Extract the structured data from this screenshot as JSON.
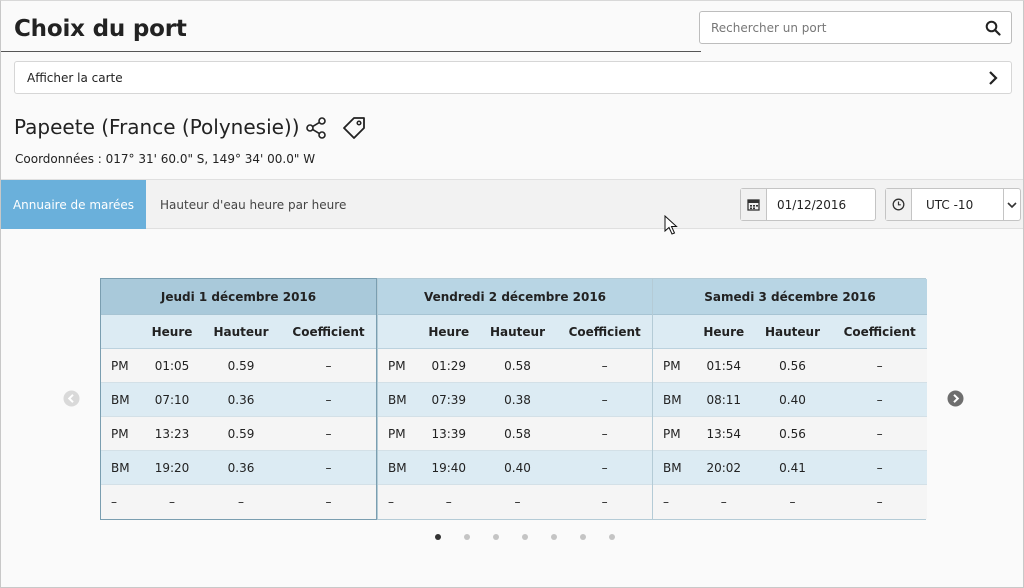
{
  "header": {
    "title": "Choix du port",
    "search_placeholder": "Rechercher un port"
  },
  "map_bar": {
    "label": "Afficher la carte"
  },
  "port": {
    "name": "Papeete (France (Polynesie))",
    "coordinates": "Coordonnées : 017° 31' 60.0\" S, 149° 34' 00.0\" W"
  },
  "tabs": [
    {
      "label": "Annuaire de marées",
      "active": true
    },
    {
      "label": "Hauteur d'eau heure par heure",
      "active": false
    }
  ],
  "controls": {
    "date": "01/12/2016",
    "timezone": "UTC -10"
  },
  "columns": {
    "time": "Heure",
    "height": "Hauteur",
    "coef": "Coefficient"
  },
  "days": [
    {
      "title": "Jeudi 1 décembre 2016",
      "rows": [
        {
          "type": "PM",
          "time": "01:05",
          "height": "0.59",
          "coef": "–"
        },
        {
          "type": "BM",
          "time": "07:10",
          "height": "0.36",
          "coef": "–"
        },
        {
          "type": "PM",
          "time": "13:23",
          "height": "0.59",
          "coef": "–"
        },
        {
          "type": "BM",
          "time": "19:20",
          "height": "0.36",
          "coef": "–"
        },
        {
          "type": "–",
          "time": "–",
          "height": "–",
          "coef": "–"
        }
      ]
    },
    {
      "title": "Vendredi 2 décembre 2016",
      "rows": [
        {
          "type": "PM",
          "time": "01:29",
          "height": "0.58",
          "coef": "–"
        },
        {
          "type": "BM",
          "time": "07:39",
          "height": "0.38",
          "coef": "–"
        },
        {
          "type": "PM",
          "time": "13:39",
          "height": "0.58",
          "coef": "–"
        },
        {
          "type": "BM",
          "time": "19:40",
          "height": "0.40",
          "coef": "–"
        },
        {
          "type": "–",
          "time": "–",
          "height": "–",
          "coef": "–"
        }
      ]
    },
    {
      "title": "Samedi 3 décembre 2016",
      "rows": [
        {
          "type": "PM",
          "time": "01:54",
          "height": "0.56",
          "coef": "–"
        },
        {
          "type": "BM",
          "time": "08:11",
          "height": "0.40",
          "coef": "–"
        },
        {
          "type": "PM",
          "time": "13:54",
          "height": "0.56",
          "coef": "–"
        },
        {
          "type": "BM",
          "time": "20:02",
          "height": "0.41",
          "coef": "–"
        },
        {
          "type": "–",
          "time": "–",
          "height": "–",
          "coef": "–"
        }
      ]
    }
  ],
  "pagination": {
    "count": 7,
    "active_index": 0
  },
  "colors": {
    "accent": "#6ab0db",
    "header_blue": "#b8d5e4",
    "row_blue": "#dcebf3"
  }
}
